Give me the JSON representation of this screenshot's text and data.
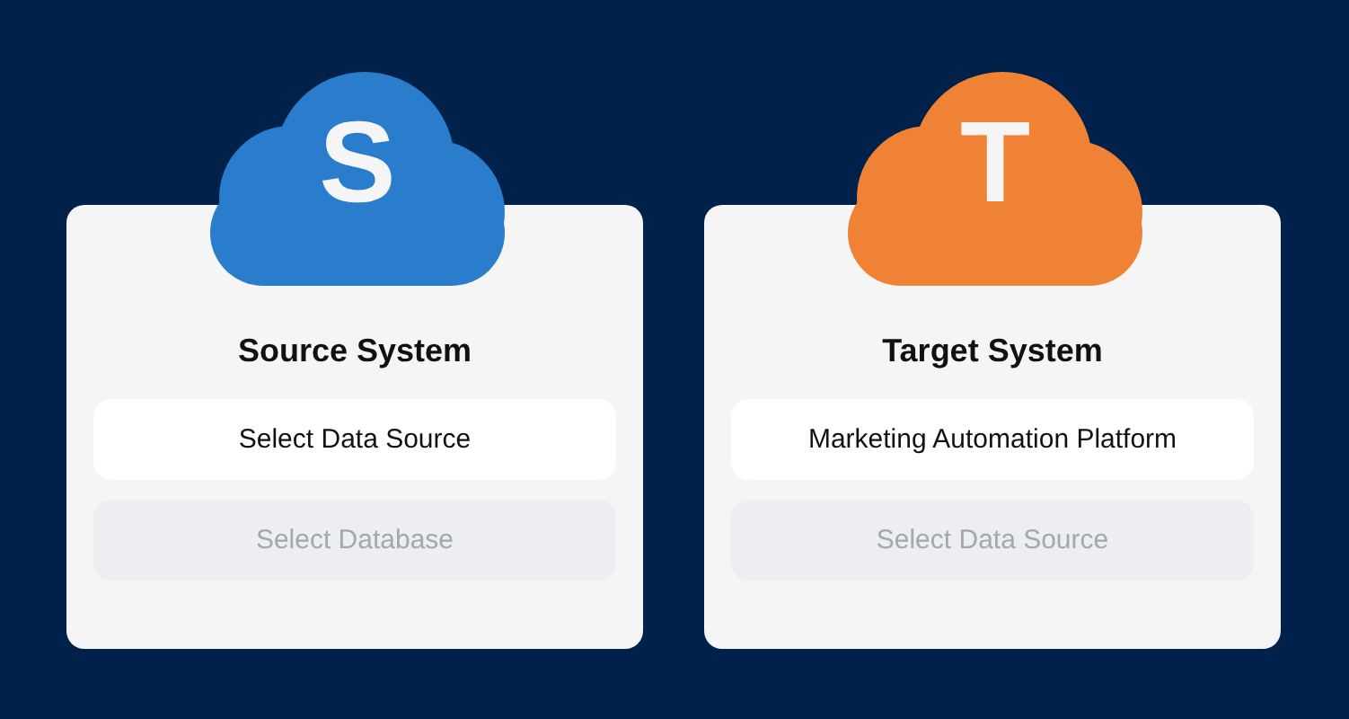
{
  "systems": [
    {
      "letter": "S",
      "color": "#2a7dcd",
      "title": "Source System",
      "selects": [
        {
          "label": "Select Data Source",
          "disabled": false
        },
        {
          "label": "Select Database",
          "disabled": true
        }
      ]
    },
    {
      "letter": "T",
      "color": "#f08236",
      "title": "Target System",
      "selects": [
        {
          "label": "Marketing Automation Platform",
          "disabled": false
        },
        {
          "label": "Select Data Source",
          "disabled": true
        }
      ]
    }
  ]
}
